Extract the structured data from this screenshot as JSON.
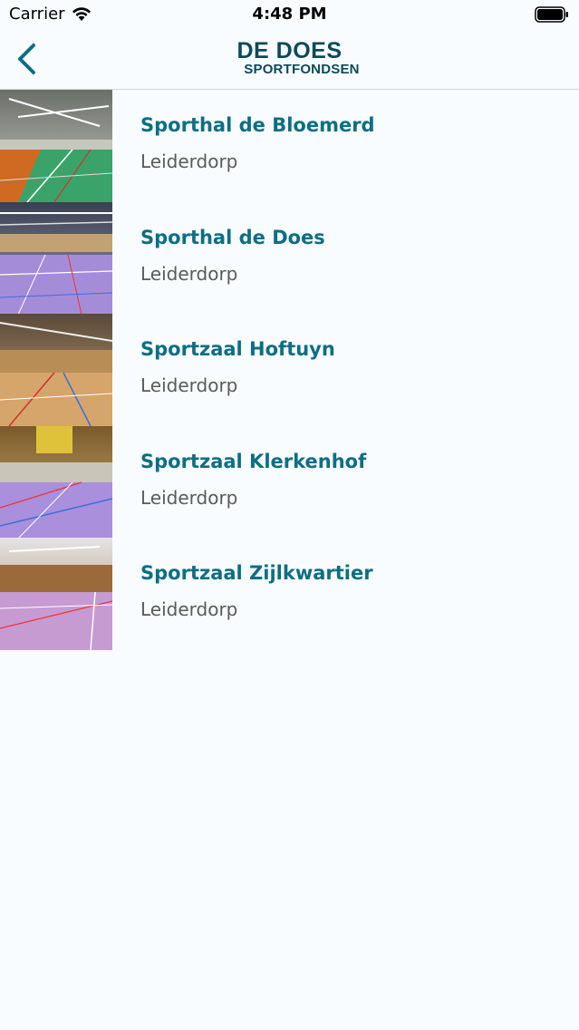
{
  "status_bar": {
    "carrier": "Carrier",
    "time": "4:48 PM"
  },
  "header": {
    "logo_line1": "DE DOES",
    "logo_line2": "SPORTFONDSEN"
  },
  "venues": [
    {
      "name": "Sporthal de Bloemerd",
      "city": "Leiderdorp",
      "image": "sports-hall-photo"
    },
    {
      "name": "Sporthal de Does",
      "city": "Leiderdorp",
      "image": "sports-hall-photo"
    },
    {
      "name": "Sportzaal Hoftuyn",
      "city": "Leiderdorp",
      "image": "sports-hall-photo"
    },
    {
      "name": "Sportzaal Klerkenhof",
      "city": "Leiderdorp",
      "image": "sports-hall-photo"
    },
    {
      "name": "Sportzaal Zijlkwartier",
      "city": "Leiderdorp",
      "image": "sports-hall-photo"
    }
  ],
  "colors": {
    "accent": "#0d6e83",
    "logo": "#0b4a5a",
    "background": "#f8fcfe"
  }
}
